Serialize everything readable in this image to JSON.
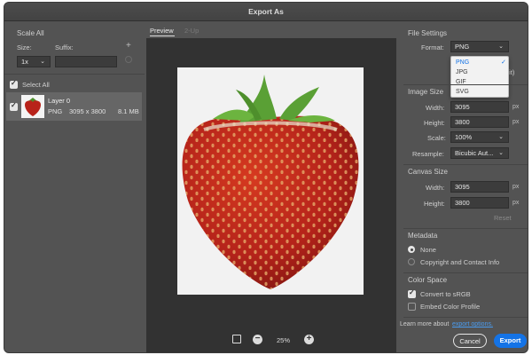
{
  "window": {
    "title": "Export As"
  },
  "left_panel": {
    "scale_all": "Scale All",
    "size_label": "Size:",
    "suffix_label": "Suffix:",
    "scale_value": "1x",
    "select_all": "Select All",
    "layer": {
      "name": "Layer 0",
      "format": "PNG",
      "dimensions": "3095 x 3800",
      "size": "8.1 MB"
    }
  },
  "tabs": {
    "preview": "Preview",
    "two_up": "2-Up"
  },
  "zoom": {
    "level": "25%"
  },
  "file_settings": {
    "heading": "File Settings",
    "format_label": "Format:",
    "format_value": "PNG",
    "format_options": [
      "PNG",
      "JPG",
      "GIF",
      "SVG"
    ],
    "hidden_suffix": "bit)"
  },
  "image_size": {
    "heading": "Image Size",
    "width_label": "Width:",
    "width_value": "3095",
    "height_label": "Height:",
    "height_value": "3800",
    "scale_label": "Scale:",
    "scale_value": "100%",
    "resample_label": "Resample:",
    "resample_value": "Bicubic Aut...",
    "unit": "px"
  },
  "canvas_size": {
    "heading": "Canvas Size",
    "width_label": "Width:",
    "width_value": "3095",
    "height_label": "Height:",
    "height_value": "3800",
    "unit": "px",
    "reset": "Reset"
  },
  "metadata": {
    "heading": "Metadata",
    "option_none": "None",
    "option_copyright": "Copyright and Contact Info"
  },
  "color_space": {
    "heading": "Color Space",
    "convert_srgb": "Convert to sRGB",
    "embed_profile": "Embed Color Profile"
  },
  "footer": {
    "learn_more": "Learn more about",
    "link": "export options.",
    "cancel": "Cancel",
    "export": "Export"
  },
  "colors": {
    "accent": "#1473e6",
    "panel": "#535353",
    "canvas": "#323232"
  }
}
